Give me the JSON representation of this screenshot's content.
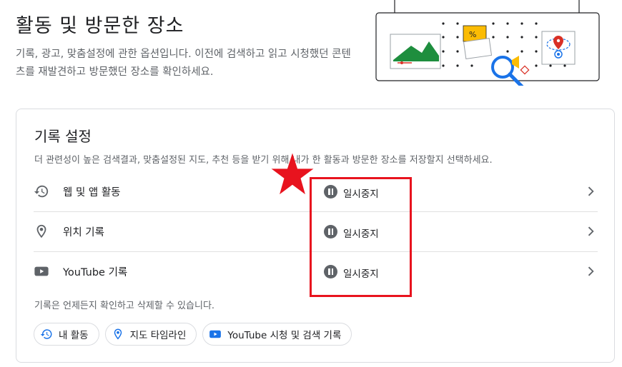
{
  "header": {
    "title": "활동 및 방문한 장소",
    "description": "기록, 광고, 맞춤설정에 관한 옵션입니다. 이전에 검색하고 읽고 시청했던 콘텐츠를 재발견하고 방문했던 장소를 확인하세요."
  },
  "history_settings": {
    "title": "기록 설정",
    "description": "더 관련성이 높은 검색결과, 맞춤설정된 지도, 추천 등을 받기 위해 내가 한 활동과 방문한 장소를 저장할지 선택하세요.",
    "rows": [
      {
        "label": "웹 및 앱 활동",
        "status": "일시중지",
        "icon": "history-icon"
      },
      {
        "label": "위치 기록",
        "status": "일시중지",
        "icon": "location-pin-icon"
      },
      {
        "label": "YouTube 기록",
        "status": "일시중지",
        "icon": "youtube-icon"
      }
    ],
    "footer_note": "기록은 언제든지 확인하고 삭제할 수 있습니다.",
    "chips": [
      {
        "label": "내 활동",
        "icon": "history-icon"
      },
      {
        "label": "지도 타임라인",
        "icon": "location-pin-icon"
      },
      {
        "label": "YouTube 시청 및 검색 기록",
        "icon": "youtube-icon"
      }
    ]
  },
  "colors": {
    "annotation_red": "#e8131e",
    "google_blue": "#1a73e8",
    "text_secondary": "#5f6368",
    "border": "#dadce0"
  }
}
